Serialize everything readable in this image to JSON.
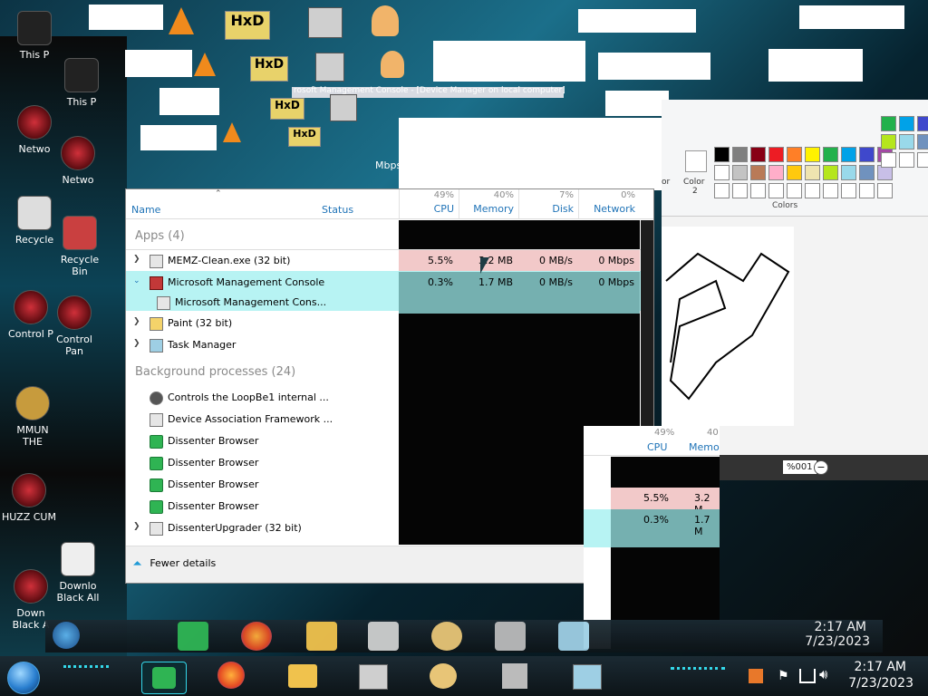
{
  "desktop_icons": [
    {
      "label": "This P",
      "kind": "pc"
    },
    {
      "label": "Netwo",
      "kind": "red"
    },
    {
      "label": "Recycle",
      "kind": "bin"
    },
    {
      "label": "Control P",
      "kind": "red"
    },
    {
      "label": "MMUN THE",
      "kind": "money"
    },
    {
      "label": "HUZZ CUM",
      "kind": "red"
    },
    {
      "label": "Down Black A",
      "kind": "red"
    }
  ],
  "desktop_icons_shifted": [
    {
      "label": "This P"
    },
    {
      "label": "Netwo"
    },
    {
      "label": "Recycle Bin"
    },
    {
      "label": "Control Pan"
    },
    {
      "label": "Downlo Black All"
    }
  ],
  "mmc_title": "rosoft Management Console - [Device Manager on local computer]",
  "speed_label": "Mbps",
  "task_manager": {
    "columns": {
      "name": "Name",
      "status": "Status",
      "cpu_pct": "49%",
      "cpu": "CPU",
      "mem_pct": "40%",
      "mem": "Memory",
      "disk_pct": "7%",
      "disk": "Disk",
      "net_pct": "0%",
      "net": "Network"
    },
    "apps_header": "Apps (4)",
    "bg_header": "Background processes (24)",
    "apps": [
      {
        "name": "MEMZ-Clean.exe (32 bit)",
        "cpu": "5.5%",
        "mem": "3.2 MB",
        "disk": "0 MB/s",
        "net": "0 Mbps"
      },
      {
        "name": "Microsoft Management Console",
        "cpu": "0.3%",
        "mem": "1.7 MB",
        "disk": "0 MB/s",
        "net": "0 Mbps"
      },
      {
        "name": "Microsoft Management Cons..."
      },
      {
        "name": "Paint (32 bit)"
      },
      {
        "name": "Task Manager"
      }
    ],
    "background": [
      {
        "name": "Controls the LoopBe1 internal ..."
      },
      {
        "name": "Device Association Framework ..."
      },
      {
        "name": "Dissenter Browser"
      },
      {
        "name": "Dissenter Browser"
      },
      {
        "name": "Dissenter Browser"
      },
      {
        "name": "Dissenter Browser"
      },
      {
        "name": "DissenterUpgrader (32 bit)"
      }
    ],
    "fewer_details": "Fewer details"
  },
  "second_tm": {
    "cpu_pct": "49%",
    "cpu": "CPU",
    "mem_pct": "40",
    "mem": "Memor",
    "row1_cpu": "5.5%",
    "row1_mem": "3.2 M",
    "row2_cpu": "0.3%",
    "row2_mem": "1.7 M"
  },
  "paint": {
    "color_label": "Color",
    "color_num": "2",
    "colors_label": "Colors",
    "partial_label": "or",
    "zoom": "%001",
    "palette_row1": [
      "#000000",
      "#7f7f7f",
      "#880015",
      "#ed1c24",
      "#ff7f27",
      "#fff200",
      "#22b14c",
      "#00a2e8",
      "#3f48cc",
      "#a349a4"
    ],
    "palette_row2": [
      "#ffffff",
      "#c3c3c3",
      "#b97a57",
      "#ffaec9",
      "#ffc90e",
      "#efe4b0",
      "#b5e61d",
      "#99d9ea",
      "#7092be",
      "#c8bfe7"
    ]
  },
  "taskbar_main": {
    "time": "2:17 AM",
    "date": "7/23/2023"
  },
  "taskbar_ghost": {
    "time": "2:17 AM",
    "date": "7/23/2023"
  },
  "colors": {
    "accent": "#1f73b7",
    "row_pink": "#f2c9c9",
    "row_teal": "#b7f3f3",
    "selected_teal": "#75b0b0",
    "taskbar_cyan": "#34d8ea"
  }
}
